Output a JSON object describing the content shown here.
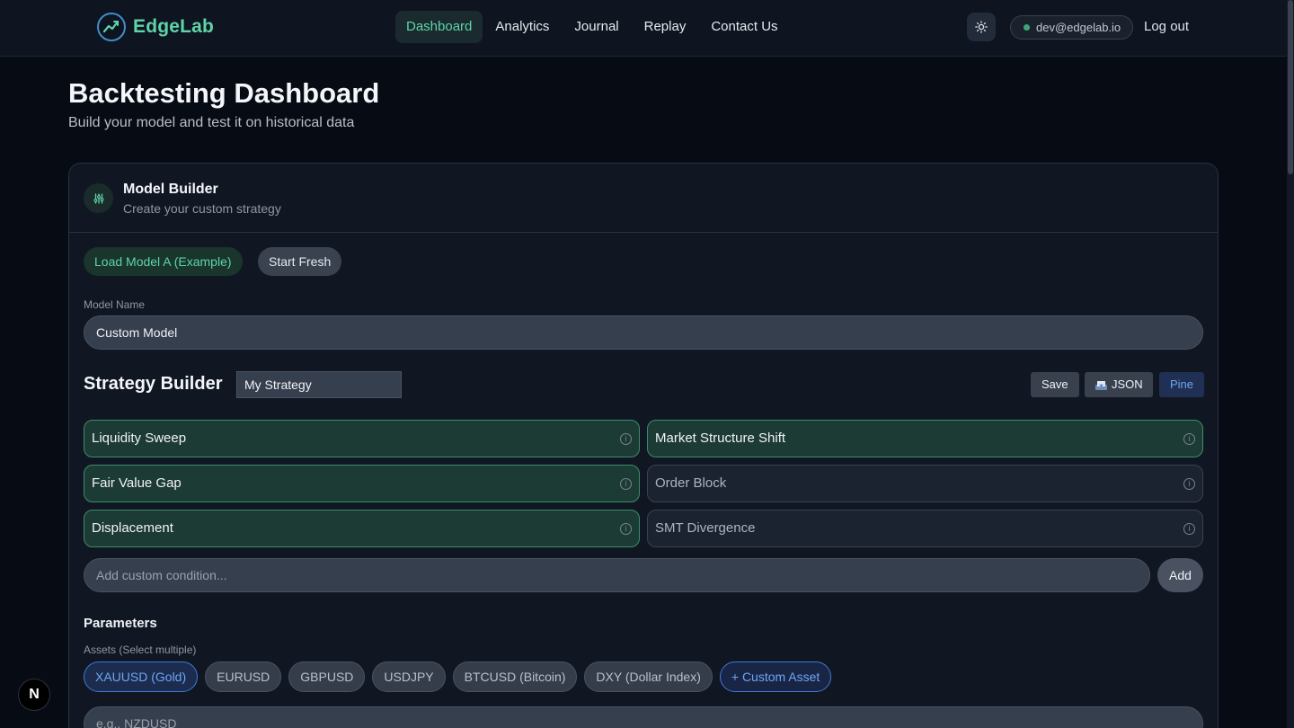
{
  "nav": {
    "brand": "EdgeLab",
    "links": [
      "Dashboard",
      "Analytics",
      "Journal",
      "Replay",
      "Contact Us"
    ],
    "active_link": "Dashboard",
    "user_email": "dev@edgelab.io",
    "logout_label": "Log out",
    "theme_icon": "sun-icon"
  },
  "header": {
    "title": "Backtesting Dashboard",
    "subtitle": "Build your model and test it on historical data"
  },
  "model_builder": {
    "title": "Model Builder",
    "subtitle": "Create your custom strategy",
    "load_example_label": "Load Model A (Example)",
    "start_fresh_label": "Start Fresh",
    "model_name_label": "Model Name",
    "model_name_value": "Custom Model"
  },
  "strategy_builder": {
    "title": "Strategy Builder",
    "strategy_name_value": "My Strategy",
    "save_label": "Save",
    "json_label": "JSON",
    "pine_label": "Pine",
    "conditions": [
      {
        "label": "Liquidity Sweep",
        "active": true
      },
      {
        "label": "Market Structure Shift",
        "active": true
      },
      {
        "label": "Fair Value Gap",
        "active": true
      },
      {
        "label": "Order Block",
        "active": false
      },
      {
        "label": "Displacement",
        "active": true
      },
      {
        "label": "SMT Divergence",
        "active": false
      }
    ],
    "custom_condition_placeholder": "Add custom condition...",
    "add_label": "Add"
  },
  "parameters": {
    "title": "Parameters",
    "assets_label": "Assets (Select multiple)",
    "assets": [
      {
        "label": "XAUUSD (Gold)",
        "selected": true
      },
      {
        "label": "EURUSD",
        "selected": false
      },
      {
        "label": "GBPUSD",
        "selected": false
      },
      {
        "label": "USDJPY",
        "selected": false
      },
      {
        "label": "BTCUSD (Bitcoin)",
        "selected": false
      },
      {
        "label": "DXY (Dollar Index)",
        "selected": false
      }
    ],
    "custom_asset_label": "+ Custom Asset",
    "custom_asset_placeholder": "e.g., NZDUSD"
  },
  "colors": {
    "accent_green": "#5ed4a8",
    "accent_blue": "#6ea6f2",
    "background": "#070b14"
  },
  "badge": {
    "label": "N"
  }
}
